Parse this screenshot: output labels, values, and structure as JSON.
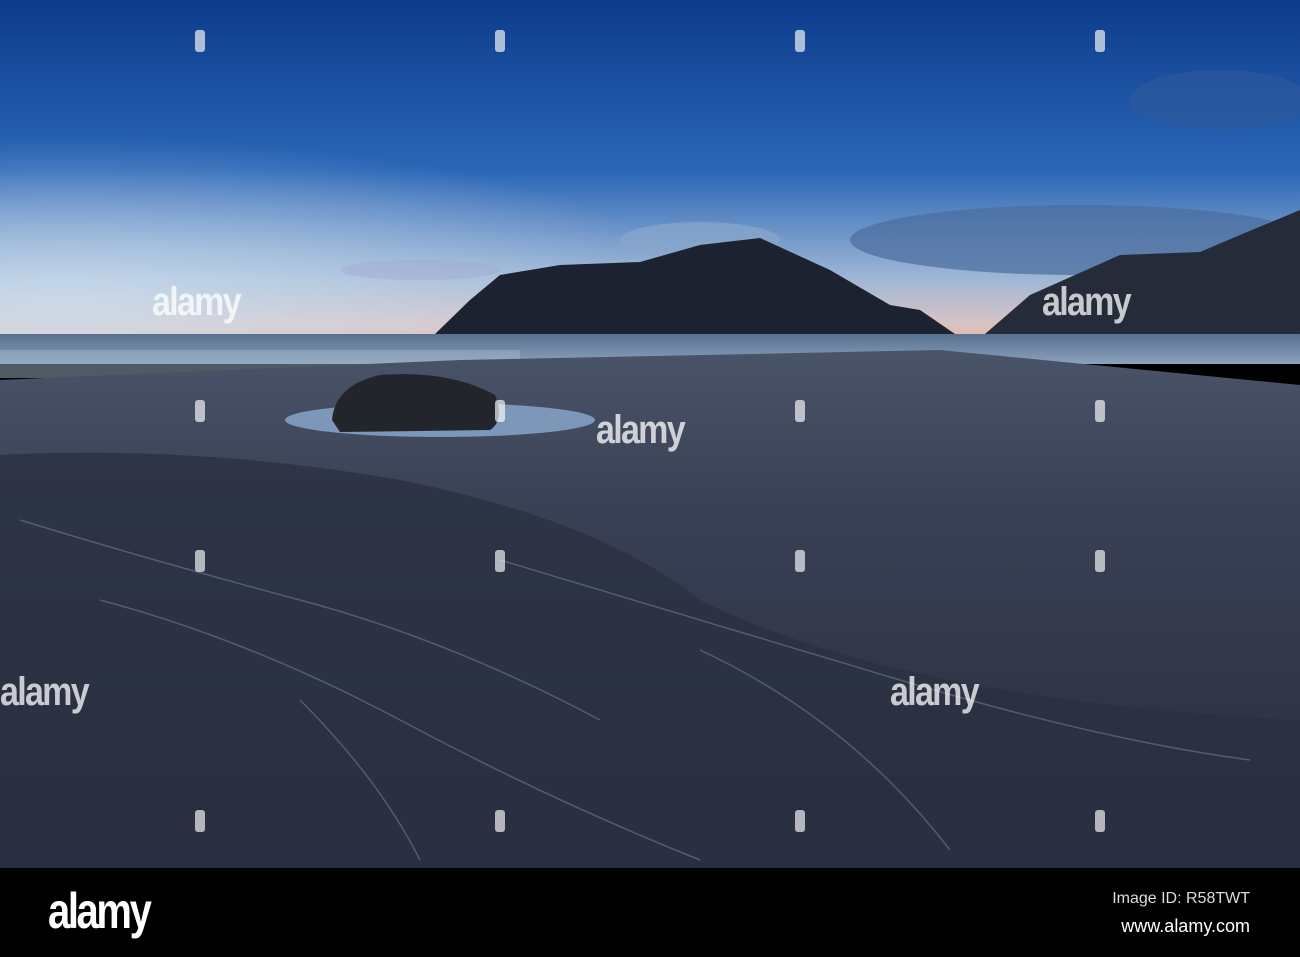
{
  "photo": {
    "subject": "twilight-beach-mountain",
    "colors": {
      "sky_top": "#0f3f8f",
      "sky_mid": "#2b67b8",
      "horizon": "#b9c6d8",
      "sunset": "#e3b7a8",
      "mountain": "#1c2230",
      "sand": "#343a4c",
      "sand_dark": "#1f2433",
      "water": "#6f87a6"
    }
  },
  "watermark": {
    "text": "alamy"
  },
  "footer": {
    "logo": "alamy",
    "image_id": "Image ID: R58TWT",
    "url": "www.alamy.com"
  }
}
